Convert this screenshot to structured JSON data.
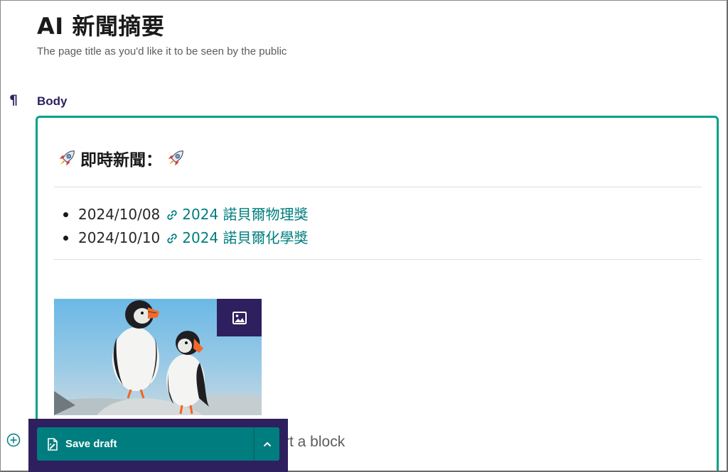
{
  "page": {
    "title": "AI 新聞摘要",
    "help_text": "The page title as you'd like it to be seen by the public"
  },
  "body_field": {
    "icon": "pilcrow-icon",
    "label": "Body"
  },
  "editor": {
    "heading": "即時新聞：",
    "heading_icon": "rocket-icon",
    "news_items": [
      {
        "date": "2024/10/08",
        "link_text": "2024 諾貝爾物理獎",
        "link_icon": "link-icon"
      },
      {
        "date": "2024/10/10",
        "link_text": "2024 諾貝爾化學獎",
        "link_icon": "link-icon"
      }
    ],
    "image_block": {
      "button_icon": "image-icon"
    },
    "insert_hint": "rt a block"
  },
  "actions": {
    "save_label": "Save draft",
    "save_icon": "document-edit-icon",
    "more_icon": "chevron-up-icon",
    "add_icon": "plus-circle-icon"
  },
  "colors": {
    "accent": "#00a287",
    "link": "#007d7e",
    "primary_dark": "#2e1f5e",
    "button": "#007d7e"
  }
}
